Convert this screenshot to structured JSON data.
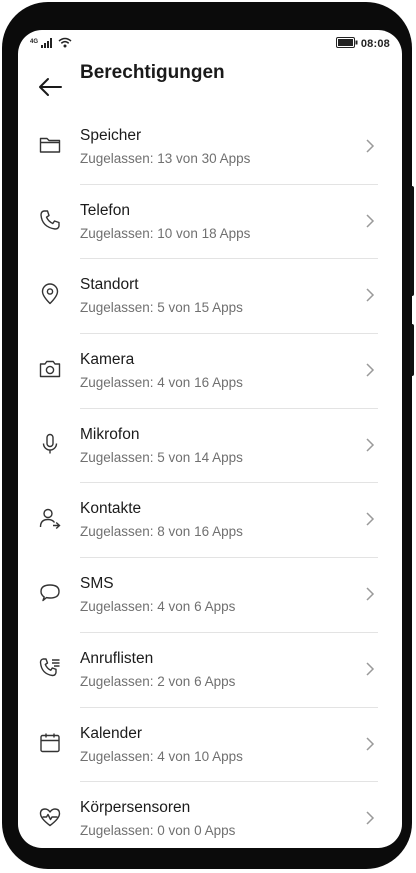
{
  "status_bar": {
    "network": "4G",
    "time": "08:08",
    "icons": [
      "signal-icon",
      "wifi-icon",
      "battery-icon"
    ]
  },
  "header": {
    "title": "Berechtigungen",
    "back_icon": "arrow-left-icon"
  },
  "permissions": [
    {
      "label": "Speicher",
      "summary": "Zugelassen: 13 von 30 Apps",
      "icon": "folder-icon"
    },
    {
      "label": "Telefon",
      "summary": "Zugelassen: 10 von 18 Apps",
      "icon": "phone-icon"
    },
    {
      "label": "Standort",
      "summary": "Zugelassen: 5 von 15 Apps",
      "icon": "location-icon"
    },
    {
      "label": "Kamera",
      "summary": "Zugelassen: 4 von 16 Apps",
      "icon": "camera-icon"
    },
    {
      "label": "Mikrofon",
      "summary": "Zugelassen: 5 von 14 Apps",
      "icon": "microphone-icon"
    },
    {
      "label": "Kontakte",
      "summary": "Zugelassen: 8 von 16 Apps",
      "icon": "contacts-icon"
    },
    {
      "label": "SMS",
      "summary": "Zugelassen: 4 von 6 Apps",
      "icon": "message-icon"
    },
    {
      "label": "Anruflisten",
      "summary": "Zugelassen: 2 von 6 Apps",
      "icon": "call-log-icon"
    },
    {
      "label": "Kalender",
      "summary": "Zugelassen: 4 von 10 Apps",
      "icon": "calendar-icon"
    },
    {
      "label": "Körpersensoren",
      "summary": "Zugelassen: 0 von 0 Apps",
      "icon": "heart-rate-icon"
    }
  ]
}
